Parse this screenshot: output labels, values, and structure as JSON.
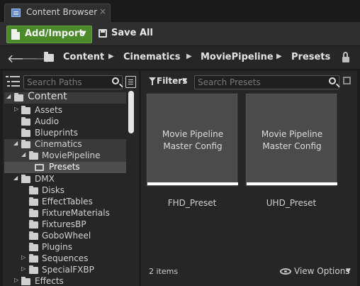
{
  "tab": {
    "title": "Content Browser",
    "close": "×"
  },
  "toolbar": {
    "add_import_label": "Add/Import",
    "save_all_label": "Save All"
  },
  "path": {
    "back": "🡐",
    "forward": "🡒",
    "crumbs": [
      "Content",
      "Cinematics",
      "MoviePipeline",
      "Presets"
    ],
    "separator": "▶"
  },
  "sidebar": {
    "search_placeholder": "Search Paths",
    "tree": [
      {
        "label": "Content"
      },
      {
        "label": "Assets"
      },
      {
        "label": "Audio"
      },
      {
        "label": "Blueprints"
      },
      {
        "label": "Cinematics"
      },
      {
        "label": "MoviePipeline"
      },
      {
        "label": "Presets"
      },
      {
        "label": "DMX"
      },
      {
        "label": "Disks"
      },
      {
        "label": "EffectTables"
      },
      {
        "label": "FixtureMaterials"
      },
      {
        "label": "FixturesBP"
      },
      {
        "label": "GoboWheel"
      },
      {
        "label": "Plugins"
      },
      {
        "label": "Sequences"
      },
      {
        "label": "SpecialFXBP"
      },
      {
        "label": "Effects"
      }
    ]
  },
  "main": {
    "filters_label": "Filters",
    "search_placeholder": "Search Presets",
    "assets": [
      {
        "thumb_line1": "Movie Pipeline",
        "thumb_line2": "Master Config",
        "name": "FHD_Preset"
      },
      {
        "thumb_line1": "Movie Pipeline",
        "thumb_line2": "Master Config",
        "name": "UHD_Preset"
      }
    ],
    "item_count": "2 items",
    "view_options_label": "View Options"
  }
}
